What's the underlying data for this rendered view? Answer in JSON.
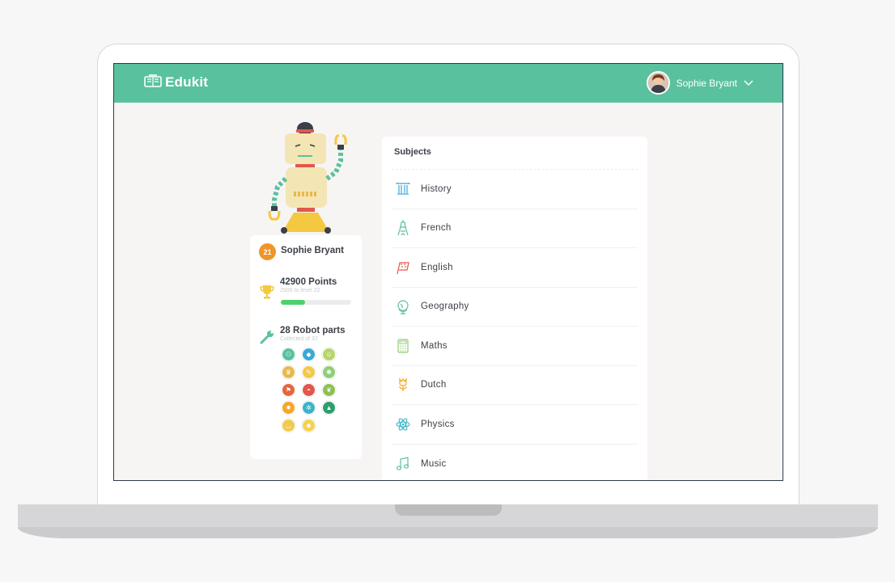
{
  "app": {
    "name": "Edukit"
  },
  "header": {
    "user_name": "Sophie Bryant"
  },
  "profile": {
    "name": "Sophie Bryant",
    "level": "21",
    "points_title": "42900 Points",
    "points_sub": "2900 to level 22",
    "progress": 0.35,
    "parts_title": "28 Robot parts",
    "parts_sub": "Collected of 32",
    "badges": [
      {
        "icon": "people-icon",
        "color": "#5ac19f",
        "glyph": "⚇"
      },
      {
        "icon": "diamond-icon",
        "color": "#3aa8d8",
        "glyph": "◆"
      },
      {
        "icon": "lion-icon",
        "color": "#b7d66a",
        "glyph": "☺"
      },
      {
        "icon": "crown-icon",
        "color": "#e9b94a",
        "glyph": "♛"
      },
      {
        "icon": "feather-icon",
        "color": "#f2c94c",
        "glyph": "✎"
      },
      {
        "icon": "cog-icon",
        "color": "#8fcf78",
        "glyph": "✺"
      },
      {
        "icon": "flag-icon",
        "color": "#e8643c",
        "glyph": "⚑"
      },
      {
        "icon": "helmet-icon",
        "color": "#e2574c",
        "glyph": "◓"
      },
      {
        "icon": "leaf-icon",
        "color": "#8cc152",
        "glyph": "❦"
      },
      {
        "icon": "star-icon",
        "color": "#f5a623",
        "glyph": "✸"
      },
      {
        "icon": "film-icon",
        "color": "#3cb4c8",
        "glyph": "✲"
      },
      {
        "icon": "tree-icon",
        "color": "#2e9e6e",
        "glyph": "▲"
      },
      {
        "icon": "sunglasses-icon",
        "color": "#f2c94c",
        "glyph": "◡"
      },
      {
        "icon": "emoji-icon",
        "color": "#f7d14f",
        "glyph": "☻"
      }
    ]
  },
  "subjects": {
    "title": "Subjects",
    "items": [
      {
        "label": "History",
        "icon": "column-icon",
        "color": "#3aa8d8"
      },
      {
        "label": "French",
        "icon": "eiffel-tower-icon",
        "color": "#5ac19f"
      },
      {
        "label": "English",
        "icon": "flag-icon",
        "color": "#e2574c"
      },
      {
        "label": "Geography",
        "icon": "globe-icon",
        "color": "#5ac19f"
      },
      {
        "label": "Maths",
        "icon": "calculator-icon",
        "color": "#8fcf78"
      },
      {
        "label": "Dutch",
        "icon": "tulip-icon",
        "color": "#f5a623"
      },
      {
        "label": "Physics",
        "icon": "atom-icon",
        "color": "#3cb4c8"
      },
      {
        "label": "Music",
        "icon": "music-note-icon",
        "color": "#5ac19f"
      }
    ]
  }
}
